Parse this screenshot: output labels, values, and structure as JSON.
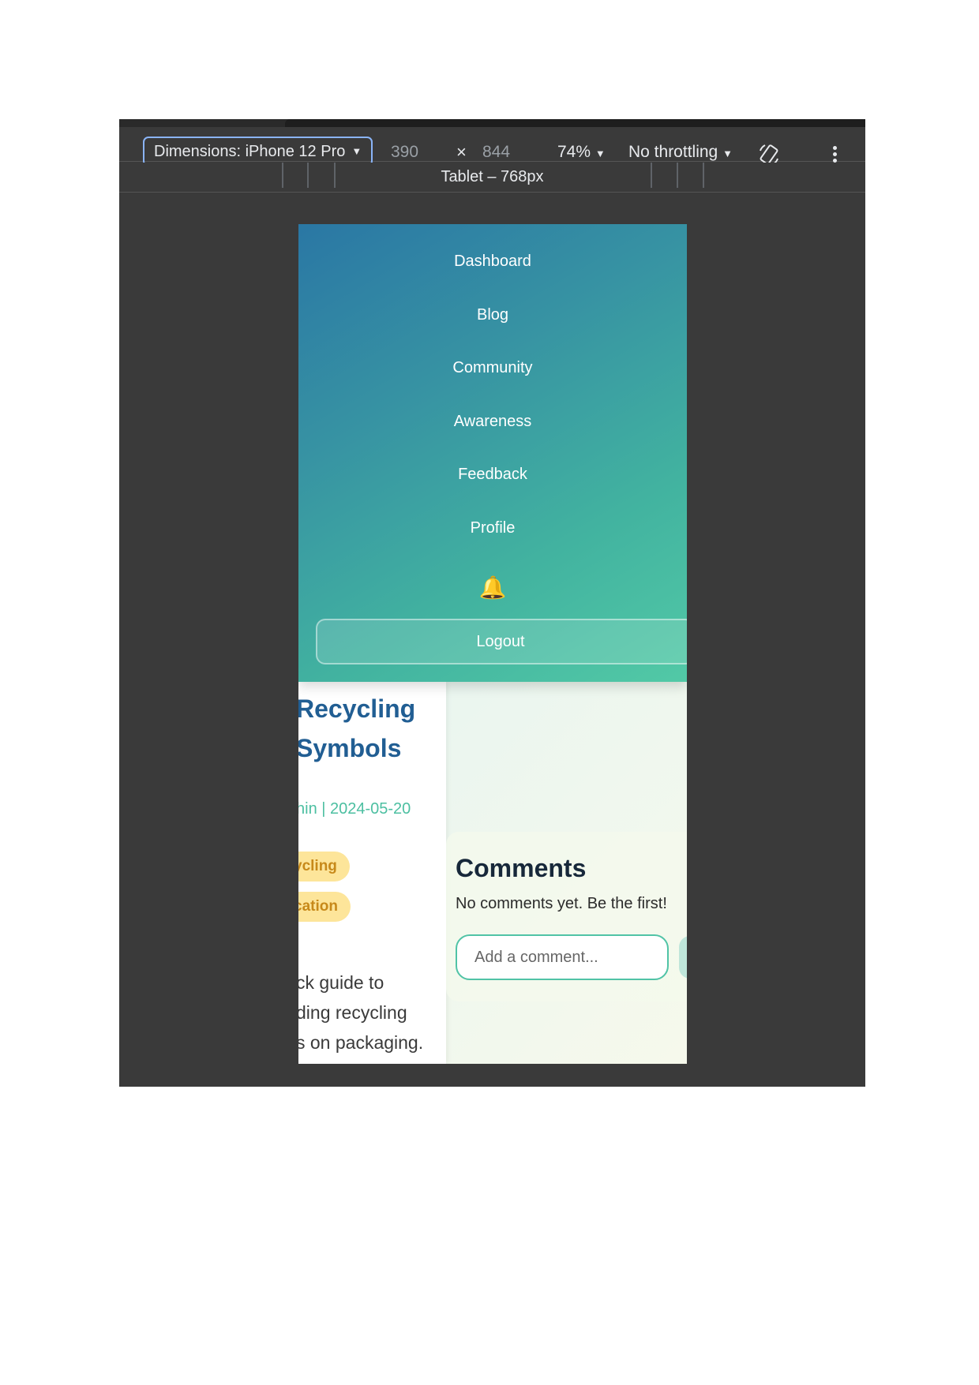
{
  "toolbar": {
    "device_label": "Dimensions: iPhone 12 Pro",
    "width": "390",
    "times": "×",
    "height": "844",
    "zoom": "74%",
    "throttling": "No throttling"
  },
  "ruler": {
    "label": "Tablet – 768px"
  },
  "nav": {
    "items": [
      "Dashboard",
      "Blog",
      "Community",
      "Awareness",
      "Feedback",
      "Profile"
    ],
    "bell": "🔔",
    "logout": "Logout"
  },
  "article": {
    "title_line1": "Recycling",
    "title_line2": "Symbols",
    "meta": "hin | 2024-05-20",
    "tags": [
      "ycling",
      "cation"
    ],
    "body_lines": [
      "ck guide to",
      "ding recycling",
      "s on packaging."
    ]
  },
  "comments": {
    "title": "Comments",
    "empty_text": "No comments yet. Be the first!",
    "input_placeholder": "Add a comment..."
  },
  "colors": {
    "nav_gradient_start": "#2a77a4",
    "nav_gradient_end": "#52c9a6",
    "title_blue": "#215e93",
    "accent_teal": "#4cbfa1",
    "tag_yellow": "#fde59a"
  }
}
